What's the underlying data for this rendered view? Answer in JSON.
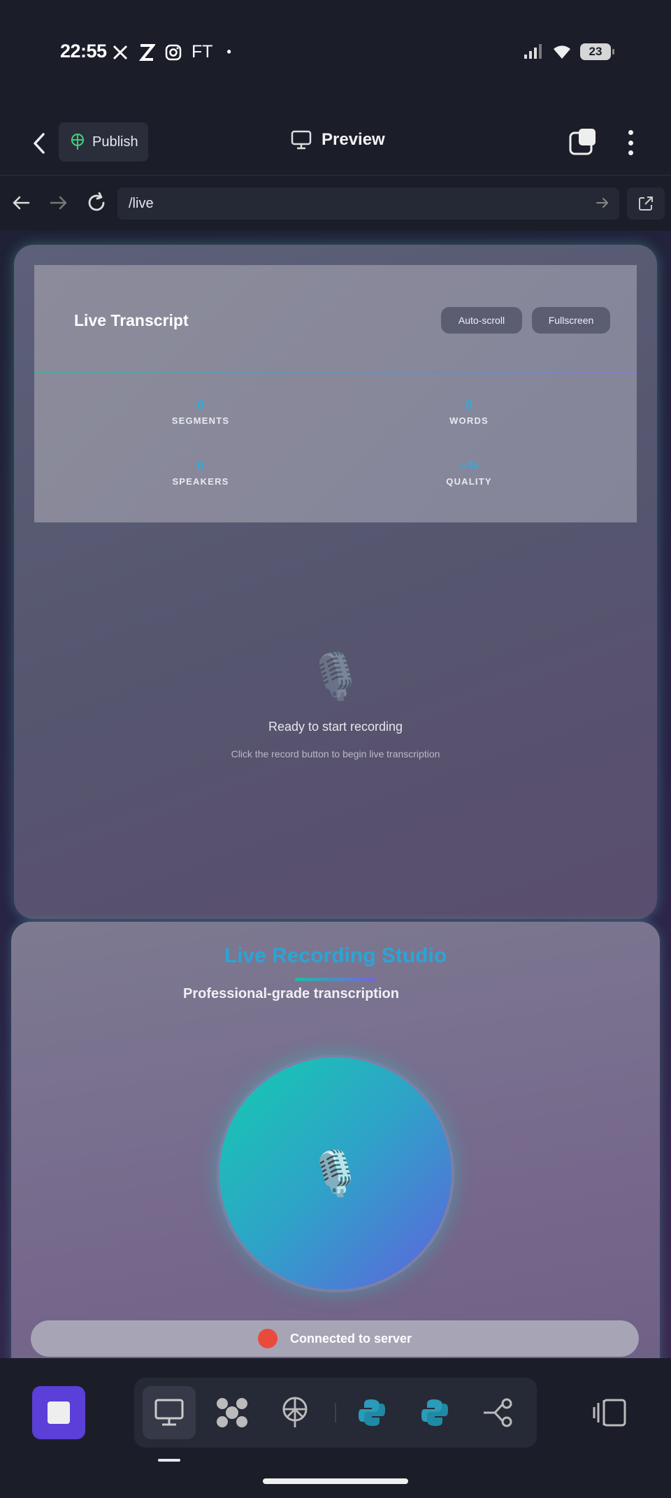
{
  "status_bar": {
    "time": "22:55",
    "apps": [
      "X",
      "Z",
      "instagram",
      "FT"
    ],
    "battery": "23"
  },
  "header": {
    "publish_label": "Publish",
    "preview_label": "Preview"
  },
  "url_bar": {
    "path": "/live"
  },
  "transcript": {
    "title": "Live Transcript",
    "autoscroll_label": "Auto-scroll",
    "fullscreen_label": "Fullscreen",
    "stats": [
      {
        "value": "0",
        "label": "SEGMENTS"
      },
      {
        "value": "0",
        "label": "WORDS"
      },
      {
        "value": "0",
        "label": "SPEAKERS"
      },
      {
        "value": "--%",
        "label": "QUALITY"
      }
    ],
    "empty_title": "Ready to start recording",
    "empty_hint": "Click the record button to begin live transcription"
  },
  "studio": {
    "title": "Live Recording Studio",
    "subtitle": "Professional-grade transcription",
    "connection_status": "Connected to server"
  },
  "colors": {
    "accent": "#2aa5d6",
    "stop_button": "#5b3fd8",
    "status_dot": "#e84b3c"
  }
}
